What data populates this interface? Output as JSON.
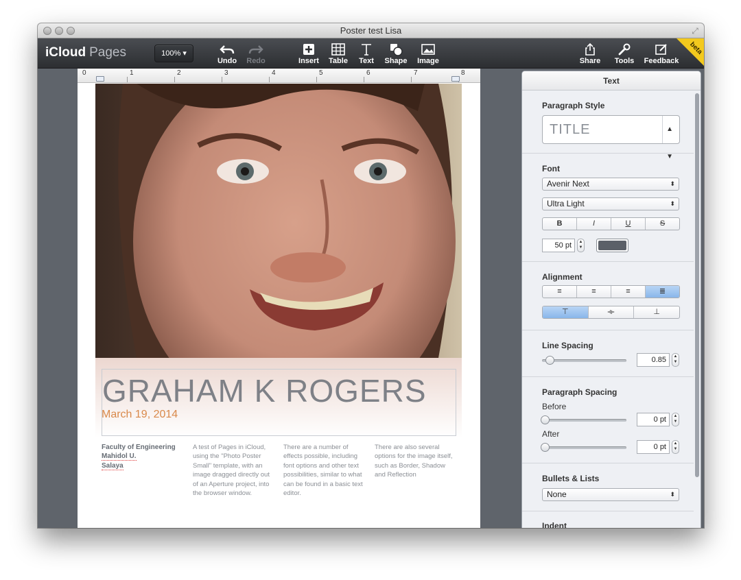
{
  "window": {
    "title": "Poster test Lisa"
  },
  "toolbar": {
    "brand_icloud": "iCloud",
    "brand_pages": "Pages",
    "zoom": "100%",
    "undo": "Undo",
    "redo": "Redo",
    "insert": "Insert",
    "table": "Table",
    "text": "Text",
    "shape": "Shape",
    "image": "Image",
    "share": "Share",
    "tools": "Tools",
    "feedback": "Feedback",
    "beta": "beta"
  },
  "ruler": {
    "numbers": [
      "0",
      "1",
      "2",
      "3",
      "4",
      "5",
      "6",
      "7",
      "8"
    ]
  },
  "poster": {
    "title": "GRAHAM K ROGERS",
    "date": "March 19, 2014",
    "col1": [
      "Faculty of Engineering",
      "Mahidol U.",
      "Salaya"
    ],
    "col2": "A test of Pages in iCloud, using the \"Photo Poster Small\" template, with an image dragged directly out of an Aperture project, into the browser window.",
    "col3": "There are a number of effects possible, including font options and other text possibilities, similar to what can be found in a basic text editor.",
    "col4": "There are also several options for the image itself, such as Border, Shadow and Reflection"
  },
  "inspector": {
    "title": "Text",
    "paragraph_style": {
      "label": "Paragraph Style",
      "value": "TITLE"
    },
    "font": {
      "label": "Font",
      "family": "Avenir Next",
      "weight": "Ultra Light",
      "styles": [
        "B",
        "I",
        "U",
        "S"
      ],
      "size": "50 pt",
      "color": "#5b6068"
    },
    "alignment": {
      "label": "Alignment",
      "horizontal_selected": "justify",
      "vertical_selected": "top"
    },
    "line_spacing": {
      "label": "Line Spacing",
      "value": "0.85"
    },
    "paragraph_spacing": {
      "label": "Paragraph Spacing",
      "before_label": "Before",
      "before_value": "0 pt",
      "after_label": "After",
      "after_value": "0 pt"
    },
    "bullets": {
      "label": "Bullets & Lists",
      "value": "None"
    },
    "indent": {
      "label": "Indent"
    }
  },
  "colors": {
    "toolbar": "#2c2e31",
    "accent_date": "#d9894a",
    "selected_segment": "#89b6ea",
    "beta": "#f3c91e"
  }
}
